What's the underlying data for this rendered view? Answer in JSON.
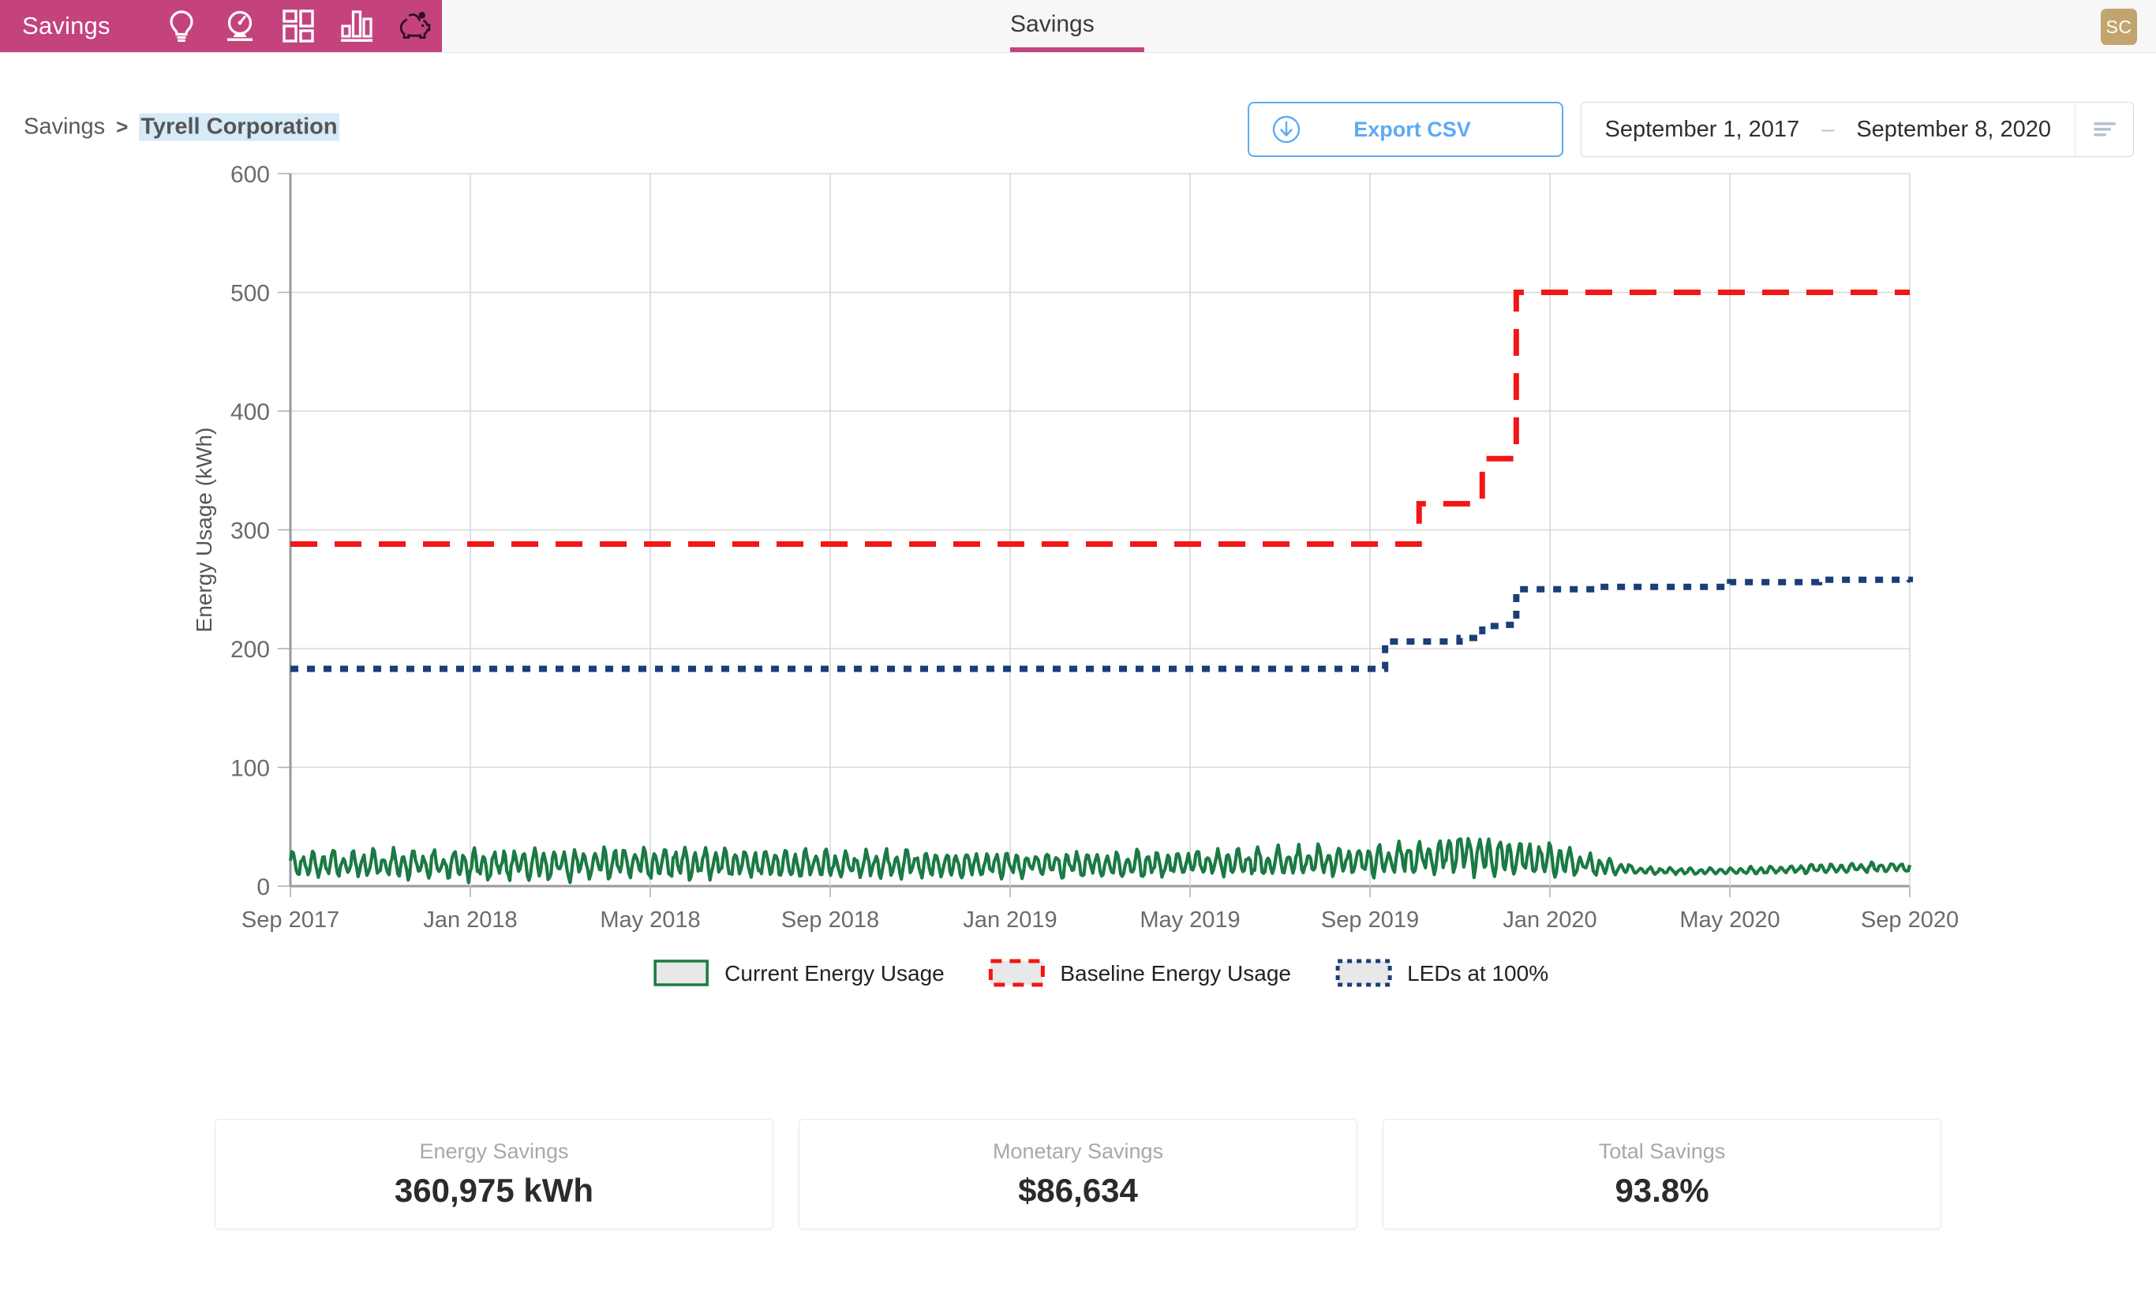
{
  "topbar": {
    "brand_label": "Savings",
    "nav_icons": [
      {
        "name": "lightbulb-icon",
        "label": "Lighting"
      },
      {
        "name": "gauge-icon",
        "label": "Metering"
      },
      {
        "name": "dashboard-grid-icon",
        "label": "Dashboard"
      },
      {
        "name": "bar-chart-icon",
        "label": "Reports"
      },
      {
        "name": "piggy-bank-icon",
        "label": "Savings"
      }
    ],
    "active_tab": "Savings",
    "avatar_initials": "SC",
    "accent_color": "#c4437d",
    "avatar_color": "#c2a56e"
  },
  "breadcrumb": {
    "root": "Savings",
    "separator": ">",
    "current": "Tyrell Corporation"
  },
  "actions": {
    "export_label": "Export CSV",
    "export_icon": "download-circle-icon",
    "export_color": "#5ea9f5",
    "date_start": "September 1, 2017",
    "date_dash": "–",
    "date_end": "September 8, 2020",
    "filter_icon": "filter-lines-icon"
  },
  "chart_data": {
    "type": "line",
    "title": "",
    "xlabel": "",
    "ylabel": "Energy Usage (kWh)",
    "ylim": [
      0,
      600
    ],
    "yticks": [
      0,
      100,
      200,
      300,
      400,
      500,
      600
    ],
    "xticks": [
      "Sep 2017",
      "Jan 2018",
      "May 2018",
      "Sep 2018",
      "Jan 2019",
      "May 2019",
      "Sep 2019",
      "Jan 2020",
      "May 2020",
      "Sep 2020"
    ],
    "grid": true,
    "legend_position": "bottom",
    "legend": [
      {
        "label": "Current Energy Usage",
        "color": "#1a7a43",
        "style": "solid"
      },
      {
        "label": "Baseline Energy Usage",
        "color": "#f21616",
        "style": "dashed"
      },
      {
        "label": "LEDs at 100%",
        "color": "#1b3e78",
        "style": "dotted"
      }
    ],
    "series": [
      {
        "name": "Baseline Energy Usage",
        "color": "#f21616",
        "style": "dashed",
        "step": true,
        "points": [
          {
            "x": "Sep 2017",
            "y": 288
          },
          {
            "x": "Sep 2019",
            "y": 288
          },
          {
            "x": "Oct 2019",
            "y": 322
          },
          {
            "x": "Nov 2019",
            "y": 322
          },
          {
            "x": "Nov 2019b",
            "y": 360
          },
          {
            "x": "Dec 2019",
            "y": 360
          },
          {
            "x": "Dec 2019b",
            "y": 500
          },
          {
            "x": "Sep 2020",
            "y": 500
          }
        ]
      },
      {
        "name": "LEDs at 100%",
        "color": "#1b3e78",
        "style": "dotted",
        "step": true,
        "points": [
          {
            "x": "Sep 2017",
            "y": 183
          },
          {
            "x": "Sep 2019",
            "y": 183
          },
          {
            "x": "Sep 2019b",
            "y": 206
          },
          {
            "x": "Nov 2019",
            "y": 209
          },
          {
            "x": "Nov 2019b",
            "y": 219
          },
          {
            "x": "Dec 2019",
            "y": 220
          },
          {
            "x": "Dec 2019b",
            "y": 250
          },
          {
            "x": "Feb 2020",
            "y": 252
          },
          {
            "x": "May 2020",
            "y": 256
          },
          {
            "x": "Jul 2020",
            "y": 258
          },
          {
            "x": "Sep 2020",
            "y": 256
          }
        ]
      },
      {
        "name": "Current Energy Usage",
        "color": "#1a7a43",
        "style": "solid",
        "description": "Daily usage oscillating between roughly 5 and 40 kWh through Feb 2020, then dropping to a flat 10-18 kWh band through Sep 2020",
        "envelope": [
          {
            "x": "Sep 2017",
            "min": 8,
            "max": 30
          },
          {
            "x": "Jan 2018",
            "min": 5,
            "max": 30
          },
          {
            "x": "May 2018",
            "min": 6,
            "max": 33
          },
          {
            "x": "Sep 2018",
            "min": 7,
            "max": 30
          },
          {
            "x": "Jan 2019",
            "min": 7,
            "max": 28
          },
          {
            "x": "May 2019",
            "min": 8,
            "max": 30
          },
          {
            "x": "Sep 2019",
            "min": 9,
            "max": 34
          },
          {
            "x": "Nov 2019",
            "min": 10,
            "max": 44
          },
          {
            "x": "Jan 2020",
            "min": 9,
            "max": 36
          },
          {
            "x": "Mar 2020",
            "min": 10,
            "max": 16
          },
          {
            "x": "May 2020",
            "min": 10,
            "max": 15
          },
          {
            "x": "Jul 2020",
            "min": 11,
            "max": 19
          },
          {
            "x": "Sep 2020",
            "min": 12,
            "max": 20
          }
        ]
      }
    ]
  },
  "cards": [
    {
      "label": "Energy Savings",
      "value": "360,975 kWh"
    },
    {
      "label": "Monetary Savings",
      "value": "$86,634"
    },
    {
      "label": "Total Savings",
      "value": "93.8%"
    }
  ]
}
